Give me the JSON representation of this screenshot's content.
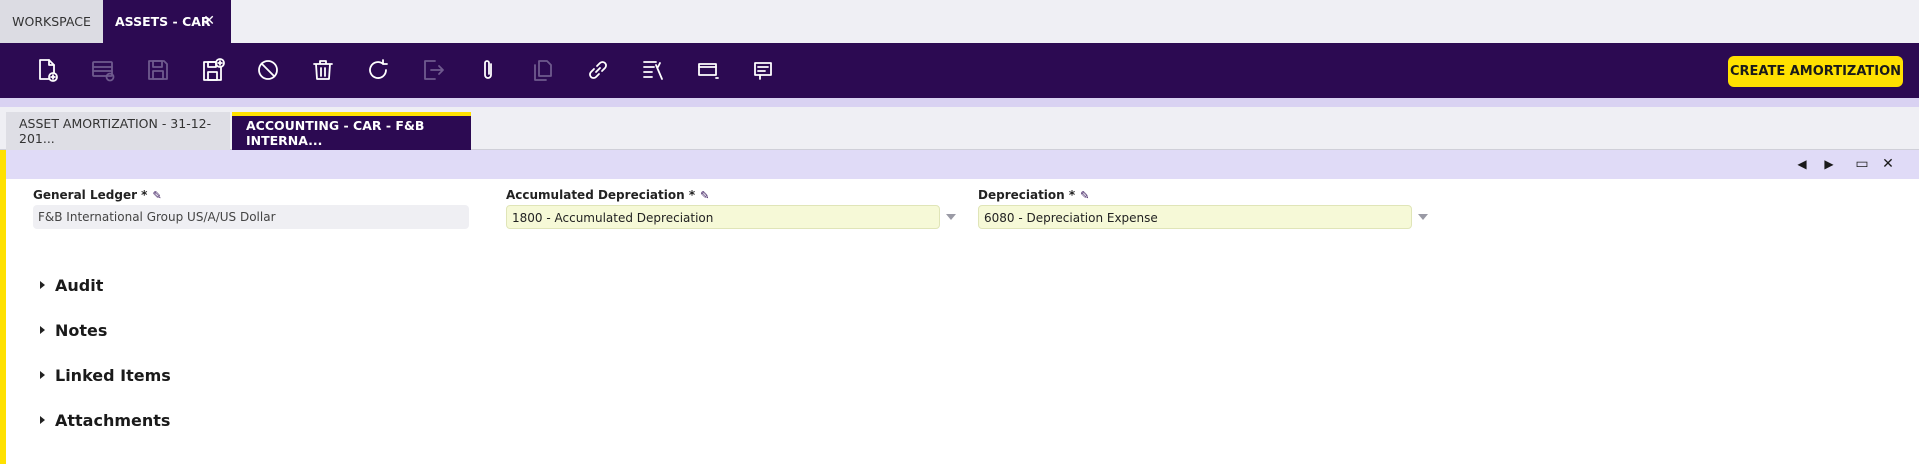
{
  "window_tabs": {
    "workspace": "WORKSPACE",
    "active": "ASSETS - CAR",
    "close_glyph": "✕"
  },
  "toolbar": {
    "buttons": [
      {
        "name": "new-document-icon",
        "enabled": true
      },
      {
        "name": "new-row-icon",
        "enabled": false
      },
      {
        "name": "save-icon",
        "enabled": false
      },
      {
        "name": "save-and-new-icon",
        "enabled": true
      },
      {
        "name": "undo-icon",
        "enabled": true
      },
      {
        "name": "delete-icon",
        "enabled": true
      },
      {
        "name": "refresh-icon",
        "enabled": true
      },
      {
        "name": "export-icon",
        "enabled": false
      },
      {
        "name": "attachment-icon",
        "enabled": true
      },
      {
        "name": "copy-record-icon",
        "enabled": false
      },
      {
        "name": "link-icon",
        "enabled": true
      },
      {
        "name": "filter-icon",
        "enabled": true
      },
      {
        "name": "grid-view-icon",
        "enabled": true
      },
      {
        "name": "notes-icon",
        "enabled": true
      }
    ],
    "create_button": "CREATE AMORTIZATION",
    "create_button_color": "#ffe100"
  },
  "sub_tabs": {
    "inactive": "ASSET AMORTIZATION - 31-12-201...",
    "active": "ACCOUNTING - CAR - F&B INTERNA..."
  },
  "form": {
    "fields": [
      {
        "label": "General Ledger *",
        "value": "F&B International Group US/A/US Dollar",
        "type": "readonly"
      },
      {
        "label": "Accumulated Depreciation *",
        "value": "1800 - Accumulated Depreciation",
        "type": "combo"
      },
      {
        "label": "Depreciation *",
        "value": "6080 - Depreciation Expense",
        "type": "combo"
      }
    ],
    "sections": [
      "Audit",
      "Notes",
      "Linked Items",
      "Attachments"
    ],
    "nav": {
      "prev": "◀",
      "next": "▶",
      "maximize": "▭",
      "close": "✕"
    }
  },
  "colors": {
    "brand_dark": "#2c0a52",
    "accent": "#ffe100",
    "header_lavender": "#e0dbf7",
    "combo_bg": "#f6f9d7"
  }
}
